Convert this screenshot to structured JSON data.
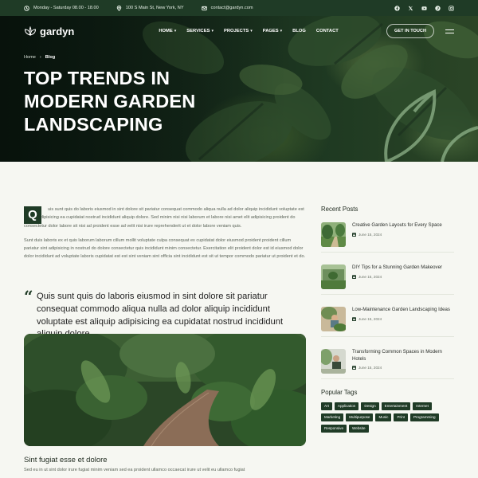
{
  "topbar": {
    "hours": "Monday - Saturday 08.00 - 18.00",
    "address": "100 S Main St, New York, NY",
    "email": "contact@gardyn.com",
    "socials": [
      "facebook-icon",
      "x-icon",
      "youtube-icon",
      "pinterest-icon",
      "instagram-icon"
    ]
  },
  "nav": {
    "logo": "gardyn",
    "items": [
      {
        "label": "HOME",
        "dropdown": true
      },
      {
        "label": "SERVICES",
        "dropdown": true
      },
      {
        "label": "PROJECTS",
        "dropdown": true
      },
      {
        "label": "PAGES",
        "dropdown": true
      },
      {
        "label": "BLOG",
        "dropdown": false
      },
      {
        "label": "CONTACT",
        "dropdown": false
      }
    ],
    "cta": "GET IN TOUCH"
  },
  "hero": {
    "breadcrumb": [
      "Home",
      "Blog"
    ],
    "title": "TOP TRENDS IN MODERN GARDEN LANDSCAPING"
  },
  "article": {
    "dropcap": "Q",
    "intro": "uis sunt quis do laboris eiusmod in sint dolore sit pariatur consequat commodo aliqua nulla ad dolor aliquip incididunt voluptate est aliquip adipisicing ea cupidatat nostrud incididunt aliquip dolore. Sed minim nisi nisi laborum et labore nisi amet elit adipisicing proident do consectetur dolor labore sit nisi ad proident esse ad velit nisi irure reprehenderit ut et dolor labore veniam quis.",
    "para2": "Sunt duis laboris ex et quis laborum laborum cillum mollit voluptate culpa consequat ex cupidatat dolor eiusmod proident proident cillum pariatur sint adipisicing in nostrud do dolore consectetur quis incididunt minim consectetur. Exercitation elit proident dolor est id eiusmod dolor dolor incididunt ad voluptate laboris cupidatat est est sint veniam sint officia sint incididunt est sit ut tempor commodo pariatur ut proident et do.",
    "quote": "Quis sunt quis do laboris eiusmod in sint dolore sit pariatur consequat commodo aliqua nulla ad dolor aliquip incididunt voluptate est aliquip adipisicing ea cupidatat nostrud incididunt aliquip dolore.",
    "subhead": "Sint fugiat esse et dolore",
    "subtext": "Sed eu in ut sint dolor irure fugiat minim veniam sed ea proident ullamco occaecat irure ut velit eu ullamco fugiat"
  },
  "sidebar": {
    "recent_title": "Recent Posts",
    "posts": [
      {
        "title": "Creative Garden Layouts for Every Space",
        "date": "June 15, 2024"
      },
      {
        "title": "DIY Tips for a Stunning Garden Makeover",
        "date": "June 15, 2024"
      },
      {
        "title": "Low-Maintenance Garden Landscaping Ideas",
        "date": "June 15, 2024"
      },
      {
        "title": "Transforming Common Spaces in Modern Hotels",
        "date": "June 15, 2024"
      }
    ],
    "tags_title": "Popular Tags",
    "tags": [
      "Art",
      "Application",
      "Design",
      "Entertainment",
      "Internet",
      "Marketing",
      "Multipurpose",
      "Music",
      "Print",
      "Programming",
      "Responsive",
      "Website"
    ]
  },
  "colors": {
    "brand_dark_green": "#1f3b26",
    "page_bg": "#f6f7f2"
  }
}
